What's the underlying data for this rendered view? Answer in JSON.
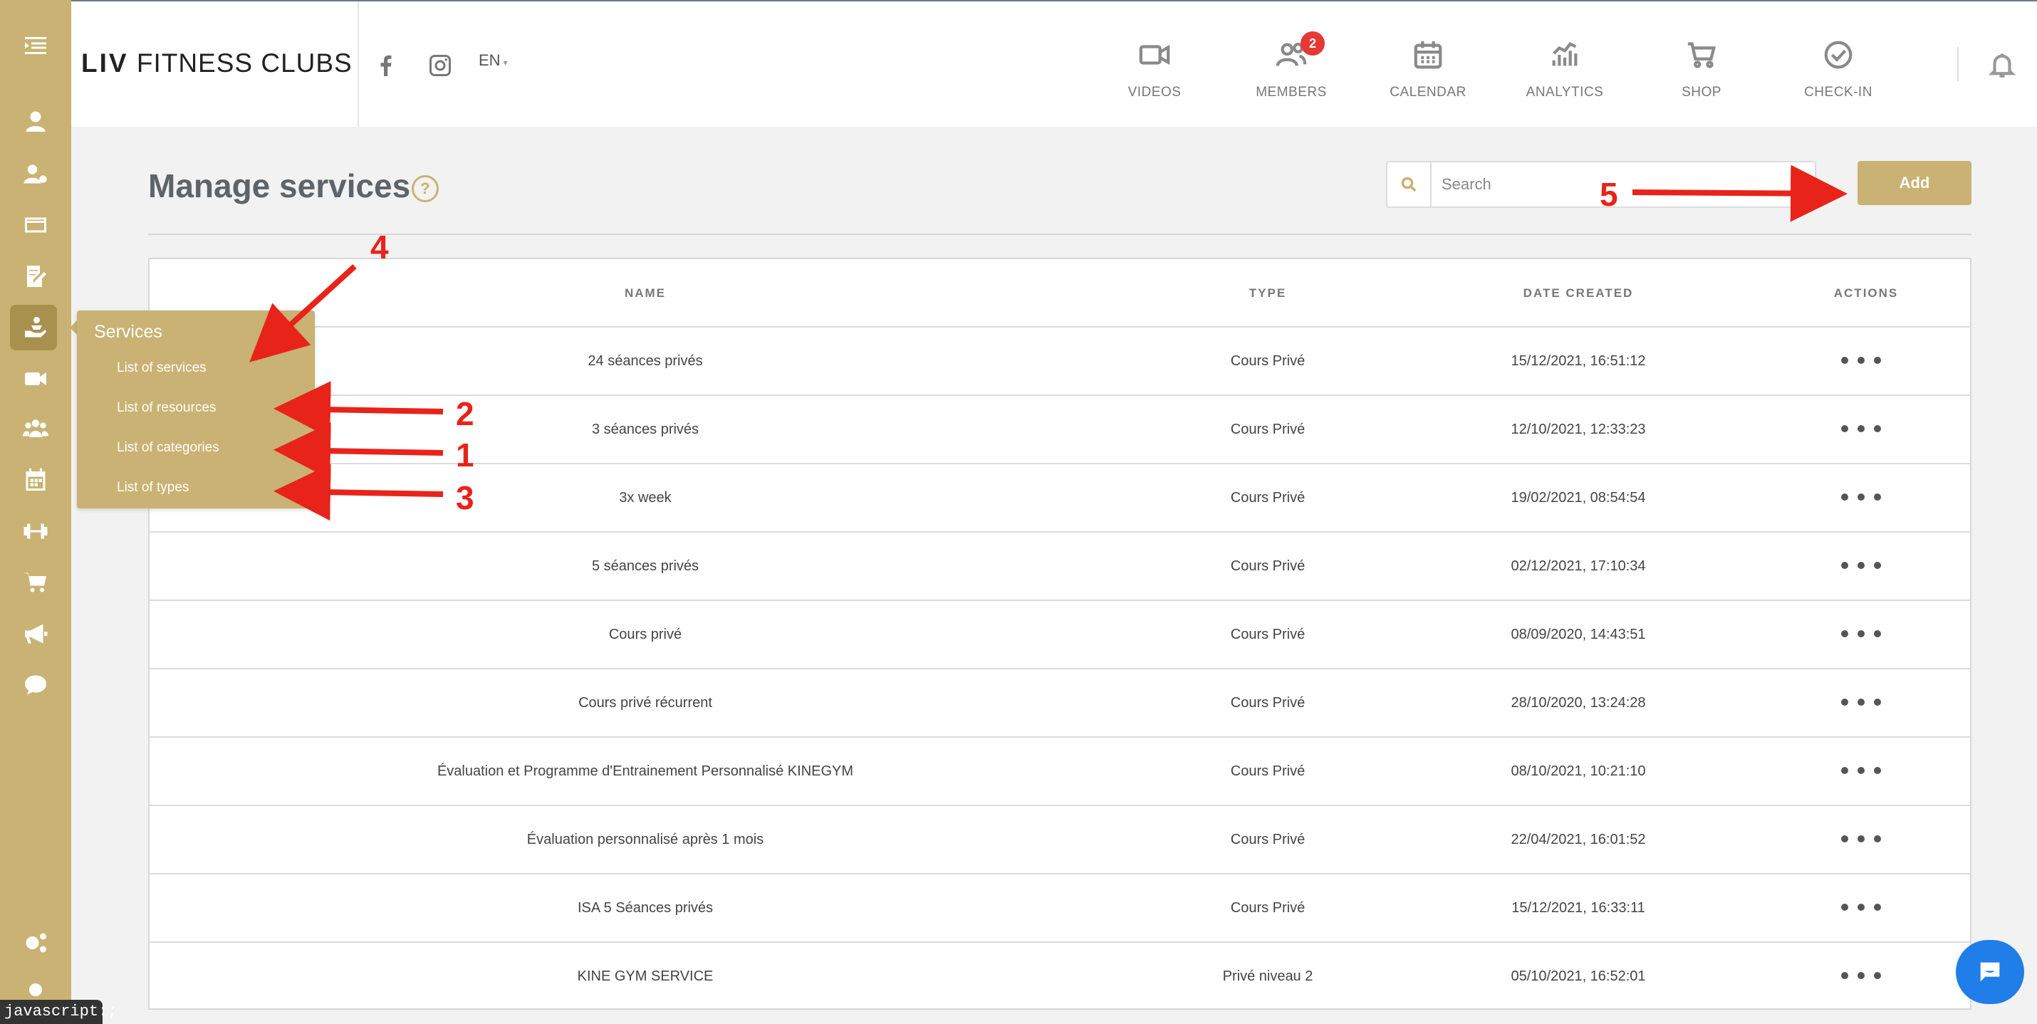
{
  "app": {
    "logo_bold": "LIV",
    "logo_rest": " FITNESS CLUBS",
    "language": "EN"
  },
  "top_nav": [
    {
      "label": "VIDEOS",
      "icon": "video-icon"
    },
    {
      "label": "MEMBERS",
      "icon": "members-icon",
      "badge": "2"
    },
    {
      "label": "CALENDAR",
      "icon": "calendar-icon"
    },
    {
      "label": "ANALYTICS",
      "icon": "analytics-icon"
    },
    {
      "label": "SHOP",
      "icon": "cart-icon"
    },
    {
      "label": "CHECK-IN",
      "icon": "check-circle-icon"
    }
  ],
  "page": {
    "title": "Manage services",
    "help": "?",
    "search_placeholder": "Search",
    "add_label": "Add"
  },
  "table": {
    "headers": {
      "name": "NAME",
      "type": "TYPE",
      "date": "DATE CREATED",
      "actions": "ACTIONS"
    },
    "rows": [
      {
        "name": "24 séances privés",
        "type": "Cours Privé",
        "date": "15/12/2021, 16:51:12"
      },
      {
        "name": "3 séances privés",
        "type": "Cours Privé",
        "date": "12/10/2021, 12:33:23"
      },
      {
        "name": "3x week",
        "type": "Cours Privé",
        "date": "19/02/2021, 08:54:54"
      },
      {
        "name": "5 séances privés",
        "type": "Cours Privé",
        "date": "02/12/2021, 17:10:34"
      },
      {
        "name": "Cours privé",
        "type": "Cours Privé",
        "date": "08/09/2020, 14:43:51"
      },
      {
        "name": "Cours privé récurrent",
        "type": "Cours Privé",
        "date": "28/10/2020, 13:24:28"
      },
      {
        "name": "Évaluation et Programme d'Entrainement Personnalisé KINEGYM",
        "type": "Cours Privé",
        "date": "08/10/2021, 10:21:10"
      },
      {
        "name": "Évaluation personnalisé après 1 mois",
        "type": "Cours Privé",
        "date": "22/04/2021, 16:01:52"
      },
      {
        "name": "ISA 5 Séances privés",
        "type": "Cours Privé",
        "date": "15/12/2021, 16:33:11"
      },
      {
        "name": "KINE GYM SERVICE",
        "type": "Privé niveau 2",
        "date": "05/10/2021, 16:52:01"
      }
    ]
  },
  "flyout": {
    "title": "Services",
    "items": [
      "List of services",
      "List of resources",
      "List of categories",
      "List of types"
    ]
  },
  "annotations": {
    "n1": "1",
    "n2": "2",
    "n3": "3",
    "n4": "4",
    "n5": "5",
    "color": "#e8231a"
  },
  "status_bar": {
    "text": "javascript:;"
  },
  "colors": {
    "accent": "#c9b273",
    "accent_dark": "#a8904f",
    "chat": "#1f7ee8",
    "badge": "#e53935"
  }
}
